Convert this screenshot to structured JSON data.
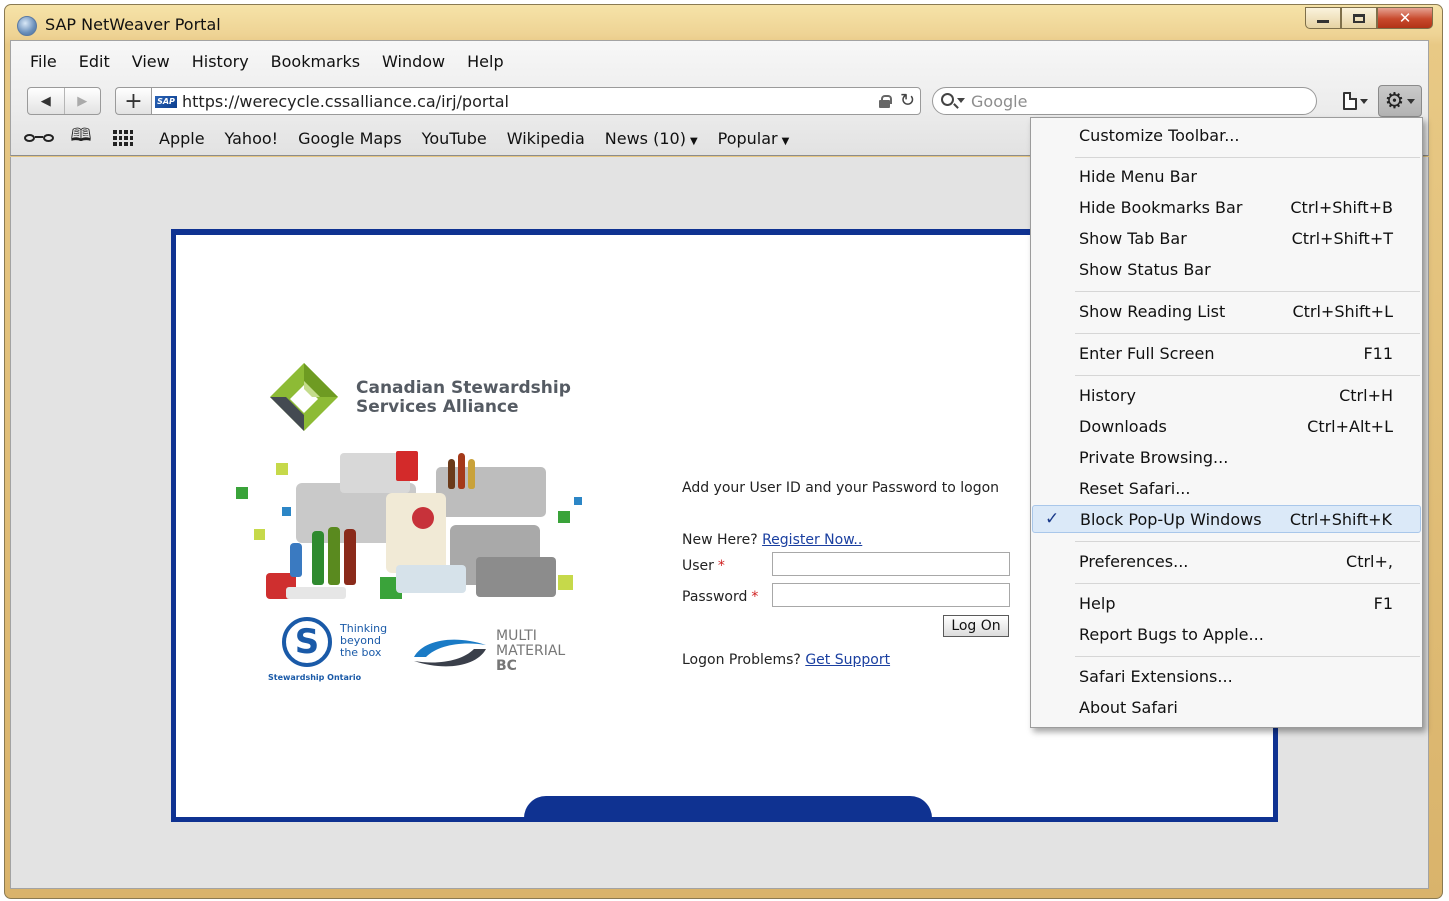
{
  "window": {
    "title": "SAP NetWeaver Portal"
  },
  "menubar": [
    "File",
    "Edit",
    "View",
    "History",
    "Bookmarks",
    "Window",
    "Help"
  ],
  "toolbar": {
    "url": "https://werecycle.cssalliance.ca/irj/portal",
    "search_placeholder": "Google",
    "site_badge": "SAP"
  },
  "bookmarks": [
    {
      "label": "Apple"
    },
    {
      "label": "Yahoo!"
    },
    {
      "label": "Google Maps"
    },
    {
      "label": "YouTube"
    },
    {
      "label": "Wikipedia"
    },
    {
      "label": "News (10)",
      "dropdown": true
    },
    {
      "label": "Popular",
      "dropdown": true
    }
  ],
  "portal": {
    "brand": {
      "name_line1": "Canadian Stewardship",
      "name_line2": "Services Alliance"
    },
    "partner1": {
      "tagline": "Thinking\nbeyond\nthe box",
      "subtext": "Stewardship Ontario"
    },
    "partner2": {
      "line1": "MULTI",
      "line2": "MATERIAL",
      "line3": "BC"
    },
    "login": {
      "instruction": "Add your User ID and your Password to logon",
      "new_here": "New Here?",
      "register_link": "Register Now..",
      "user_label": "User",
      "password_label": "Password",
      "required_mark": "*",
      "logon_button": "Log On",
      "problems_label": "Logon Problems?",
      "support_link": "Get Support"
    }
  },
  "settings_menu": {
    "items": [
      {
        "label": "Customize Toolbar...",
        "shortcut": ""
      },
      {
        "label": "Hide Menu Bar",
        "shortcut": ""
      },
      {
        "label": "Hide Bookmarks Bar",
        "shortcut": "Ctrl+Shift+B"
      },
      {
        "label": "Show Tab Bar",
        "shortcut": "Ctrl+Shift+T"
      },
      {
        "label": "Show Status Bar",
        "shortcut": ""
      },
      {
        "label": "Show Reading List",
        "shortcut": "Ctrl+Shift+L"
      },
      {
        "label": "Enter Full Screen",
        "shortcut": "F11"
      },
      {
        "label": "History",
        "shortcut": "Ctrl+H"
      },
      {
        "label": "Downloads",
        "shortcut": "Ctrl+Alt+L"
      },
      {
        "label": "Private Browsing...",
        "shortcut": ""
      },
      {
        "label": "Reset Safari...",
        "shortcut": ""
      },
      {
        "label": "Block Pop-Up Windows",
        "shortcut": "Ctrl+Shift+K",
        "checked": true
      },
      {
        "label": "Preferences...",
        "shortcut": "Ctrl+,"
      },
      {
        "label": "Help",
        "shortcut": "F1"
      },
      {
        "label": "Report Bugs to Apple...",
        "shortcut": ""
      },
      {
        "label": "Safari Extensions...",
        "shortcut": ""
      },
      {
        "label": "About Safari",
        "shortcut": ""
      }
    ],
    "check_mark": "✓"
  },
  "colors": {
    "portal_border": "#0f3291",
    "link": "#1a3fa0",
    "required": "#d02020",
    "menu_highlight": "#dbe9f8"
  }
}
